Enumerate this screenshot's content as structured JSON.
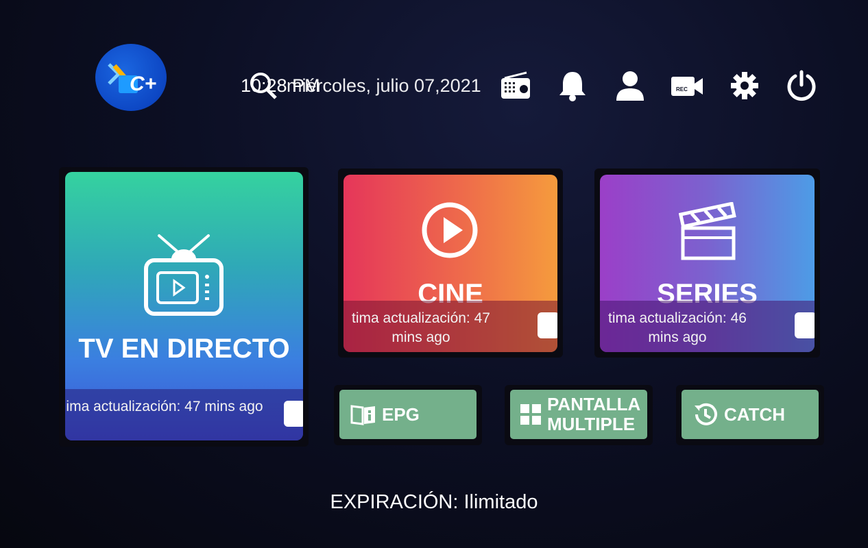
{
  "header": {
    "time": "10:28 PM",
    "date": "miércoles, julio 07,2021",
    "search_icon": "search-icon",
    "icons": [
      "radio-icon",
      "bell-icon",
      "user-icon",
      "rec-camera-icon",
      "gear-icon",
      "power-icon"
    ]
  },
  "logo": {
    "text": "C+"
  },
  "tiles": {
    "tv": {
      "title": "TV EN DIRECTO",
      "update": "ima actualización: 47 mins ago"
    },
    "cine": {
      "title": "CINE",
      "update_line1": "tima actualización: 47",
      "update_line2": "mins ago"
    },
    "series": {
      "title": "SERIES",
      "update_line1": "tima actualización: 46",
      "update_line2": "mins ago"
    }
  },
  "buttons": {
    "epg": "EPG",
    "multi_line1": "PANTALLA",
    "multi_line2": "MULTIPLE",
    "catch": "CATCH"
  },
  "footer": {
    "expiration": "EXPIRACIÓN: Ilimitado"
  },
  "colors": {
    "button_green": "#74b08b",
    "background": "#0c0f24"
  }
}
